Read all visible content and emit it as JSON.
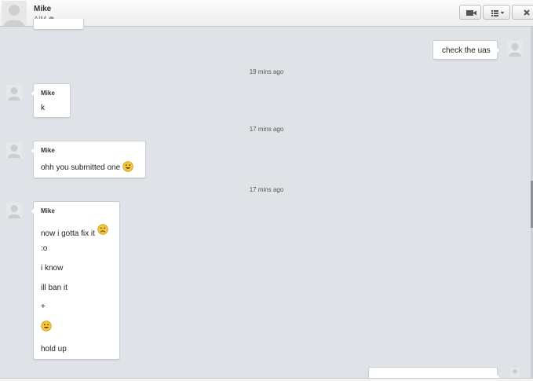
{
  "header": {
    "contact_name": "Mike",
    "contact_status": "AIM"
  },
  "messages": {
    "outgoing_1": "check the uas",
    "timestamp_1": "19 mins ago",
    "mike_1_sender": "Mike",
    "mike_1_text": "k",
    "timestamp_2": "17 mins ago",
    "mike_2_sender": "Mike",
    "mike_2_text": "ohh you submitted one",
    "timestamp_3": "17 mins ago",
    "mike_3_sender": "Mike",
    "mike_3_lines": [
      "now i gotta fix it",
      ":o",
      "i know",
      "ill ban it",
      "+",
      "hold up"
    ]
  },
  "icons": {
    "smile": "smile-emoji-icon",
    "sad": "sad-emoji-icon",
    "video": "video-camera-icon",
    "menu": "list-menu-icon",
    "close": "close-icon"
  },
  "colors": {
    "background": "#dfe3e7",
    "bubble": "#ffffff",
    "emoji": "#f5c73a"
  }
}
